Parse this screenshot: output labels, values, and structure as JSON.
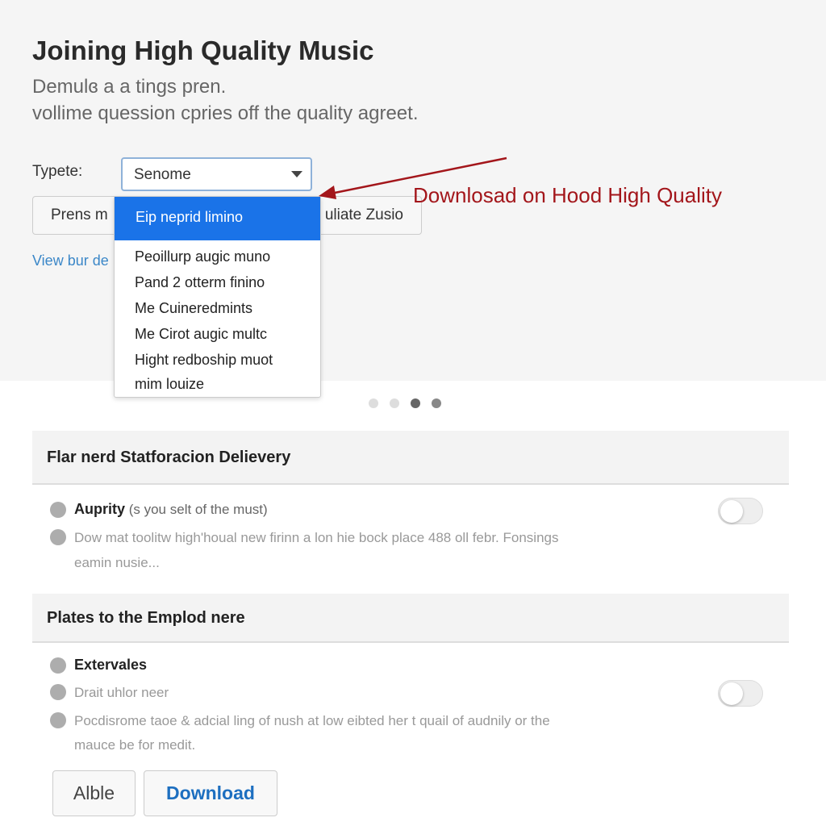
{
  "header": {
    "title": "Joining High Quality Music",
    "subtitle_1": "Demulɞ a a tings pren.",
    "subtitle_2": "vollime quession cpries off the quality agreet."
  },
  "form": {
    "type_label": "Typete:",
    "select_value": "Senome",
    "button_left": "Prens m",
    "button_right": "uliate Zusio",
    "link": "View bur de"
  },
  "dropdown": {
    "options": [
      "Eip neprid limino",
      "Peoillurp augic muno",
      "Pand 2 otterm finino",
      "Me Cuineredmints",
      "Me Cirot augic multc",
      "Hight redboship muot",
      "mim louize"
    ],
    "selected_index": 0
  },
  "annotation": {
    "text": "Downlosad on Hood High Quality",
    "color": "#a3161b"
  },
  "carousel": {
    "dots": 4,
    "active": [
      2,
      3
    ]
  },
  "sections": [
    {
      "title": "Flar nerd Statforacion Delievery",
      "rows": [
        {
          "bold": "Auprity",
          "text": " (s you selt of the must)"
        },
        {
          "text": "Dow mat toolitw high'houal new firinn a lon hie bock place 488 oll febr. Fonsings"
        },
        {
          "text": "eamin nusie..."
        }
      ],
      "toggle_on": false
    },
    {
      "title": "Plates to the Emplod nere",
      "rows": [
        {
          "bold": "Extervales",
          "text": ""
        },
        {
          "text": "Drait uhlor neer"
        },
        {
          "text": "Pocdisrome taoe & adcial ling of nush at low eibted her t quail of audnily or the"
        },
        {
          "text": "mauce be for medit."
        }
      ],
      "toggle_on": false
    }
  ],
  "footer": {
    "able": "Alble",
    "download": "Download"
  },
  "colors": {
    "accent": "#1a73e8",
    "link": "#3b87c8",
    "download_text": "#1d6fc0"
  }
}
